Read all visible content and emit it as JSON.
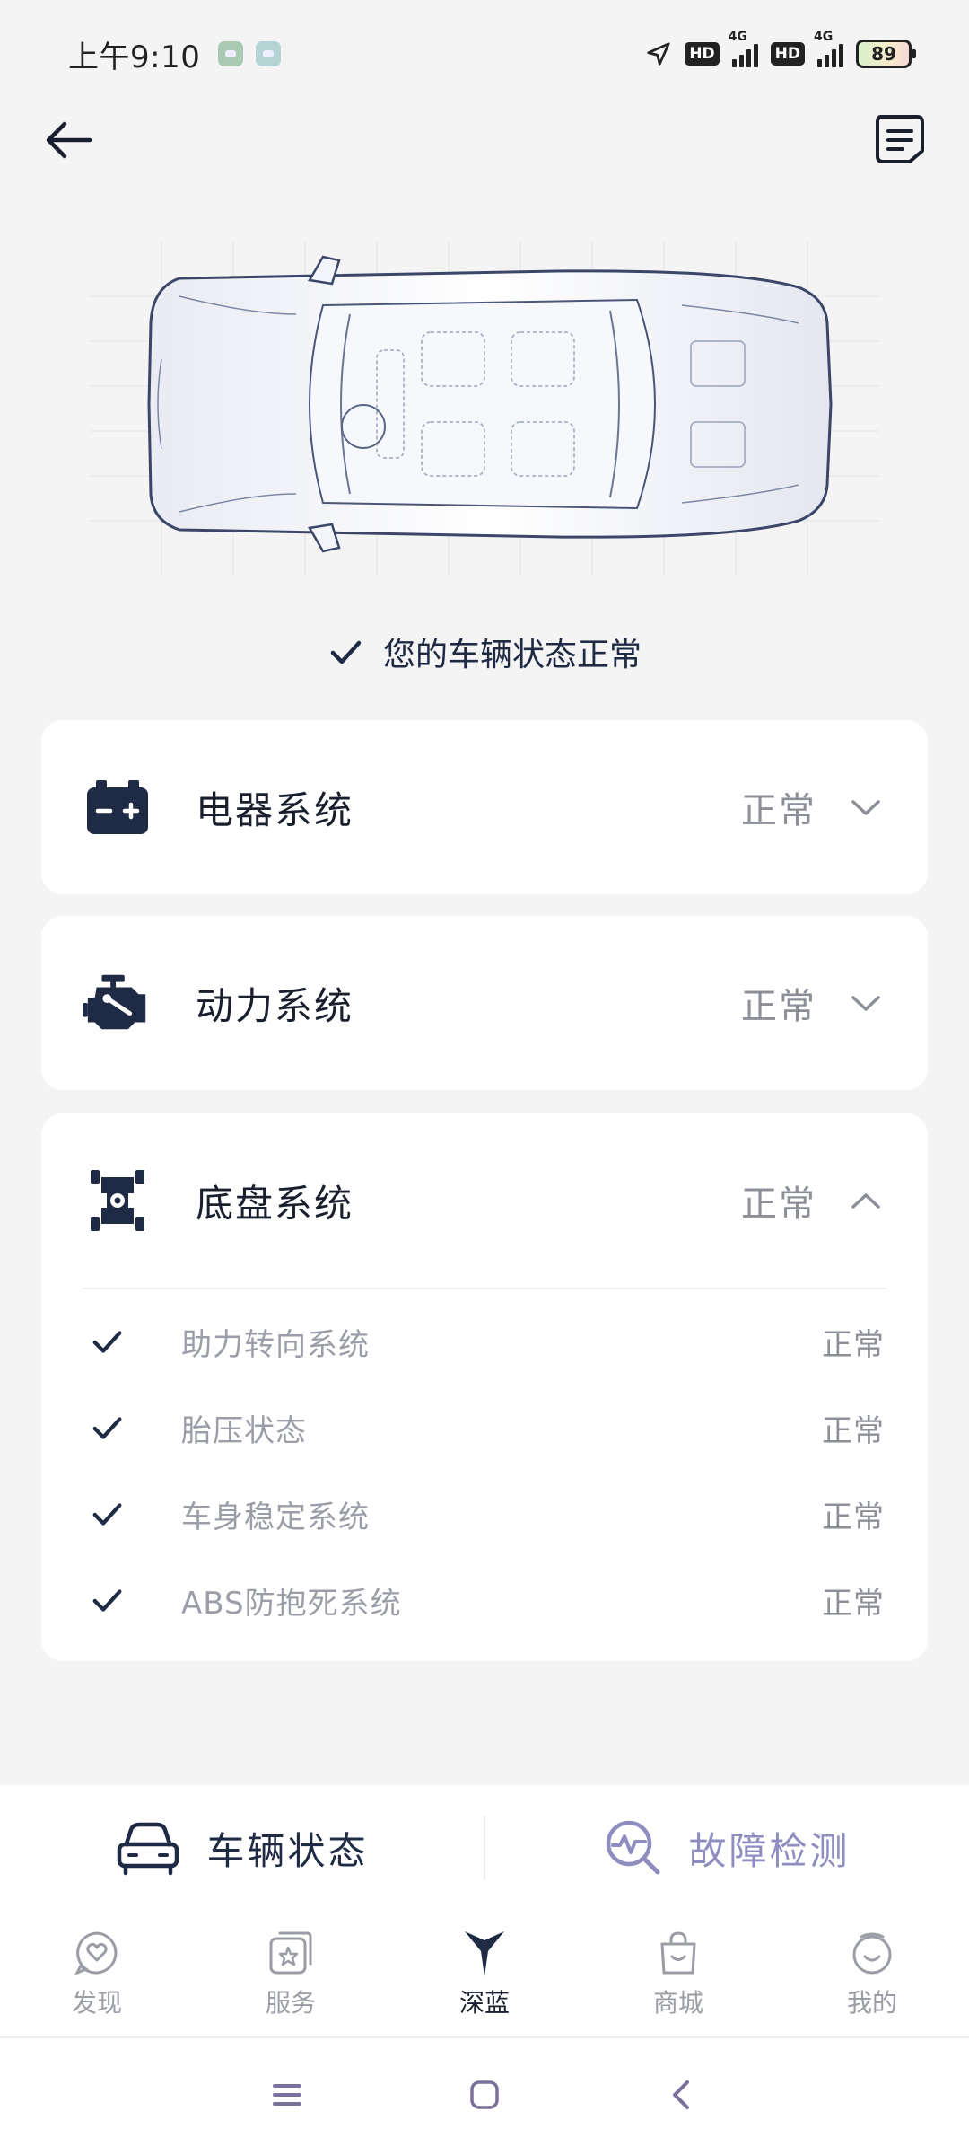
{
  "status_bar": {
    "time": "上午9:10",
    "hd_label": "HD",
    "network": "4G",
    "battery": "89"
  },
  "vehicle": {
    "summary": "您的车辆状态正常"
  },
  "systems": [
    {
      "title": "电器系统",
      "status": "正常",
      "expanded": false,
      "icon": "battery-icon"
    },
    {
      "title": "动力系统",
      "status": "正常",
      "expanded": false,
      "icon": "engine-icon"
    },
    {
      "title": "底盘系统",
      "status": "正常",
      "expanded": true,
      "icon": "chassis-icon",
      "items": [
        {
          "label": "助力转向系统",
          "status": "正常"
        },
        {
          "label": "胎压状态",
          "status": "正常"
        },
        {
          "label": "车身稳定系统",
          "status": "正常"
        },
        {
          "label": "ABS防抱死系统",
          "status": "正常"
        }
      ]
    }
  ],
  "actions": {
    "vehicle_status": "车辆状态",
    "fault_detection": "故障检测"
  },
  "tabs": [
    {
      "label": "发现",
      "icon": "heart-chat-icon"
    },
    {
      "label": "服务",
      "icon": "service-icon"
    },
    {
      "label": "深蓝",
      "icon": "brand-logo-icon",
      "active": true
    },
    {
      "label": "商城",
      "icon": "shopping-bag-icon"
    },
    {
      "label": "我的",
      "icon": "profile-icon"
    }
  ],
  "colors": {
    "primary": "#1f2a44",
    "muted_text": "#9b9ea8",
    "accent_purple": "#8f8cc0",
    "background": "#f4f4f4"
  }
}
